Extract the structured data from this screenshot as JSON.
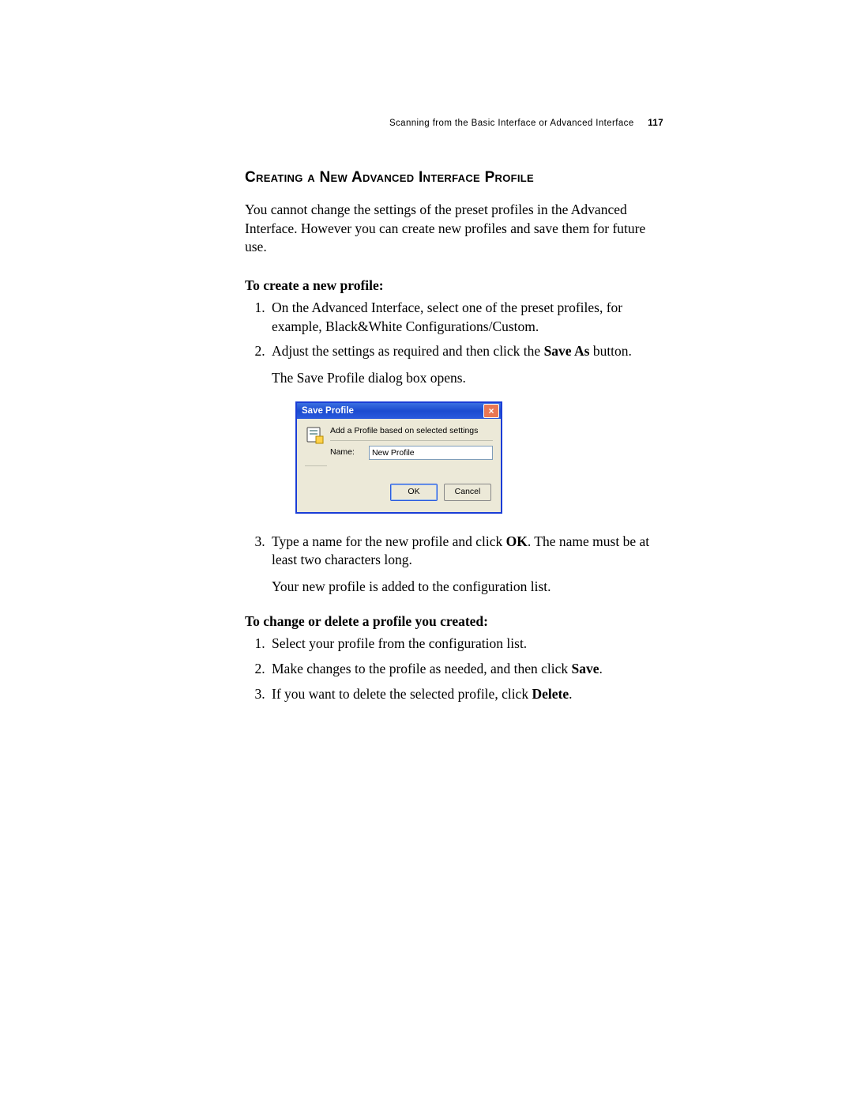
{
  "header": {
    "running_head": "Scanning from the Basic Interface or Advanced Interface",
    "page_number": "117"
  },
  "section": {
    "title": "Creating a New Advanced Interface Profile",
    "intro": "You cannot change the settings of the preset profiles in the Advanced Interface. However you can create new profiles and save them for future use."
  },
  "create_profile": {
    "heading": "To create a new profile:",
    "steps": [
      {
        "text_before": "On the Advanced Interface, select one of the preset profiles, for example, Black&White Configurations/Custom."
      },
      {
        "text_before": "Adjust the settings as required and then click the ",
        "bold": "Save As",
        "text_after": " button.",
        "extra": "The Save Profile dialog box opens."
      },
      {
        "text_before": "Type a name for the new profile and click ",
        "bold": "OK",
        "text_after": ". The name must be at least two characters long.",
        "extra": "Your new profile is added to the configuration list."
      }
    ]
  },
  "dialog": {
    "title": "Save Profile",
    "close_glyph": "×",
    "description": "Add a Profile based on selected settings",
    "name_label": "Name:",
    "name_value": "New Profile",
    "ok_label": "OK",
    "cancel_label": "Cancel"
  },
  "change_delete": {
    "heading": "To change or delete a profile you created:",
    "steps": [
      {
        "text_before": "Select your profile from the configuration list."
      },
      {
        "text_before": "Make changes to the profile as needed, and then click ",
        "bold": "Save",
        "text_after": "."
      },
      {
        "text_before": "If you want to delete the selected profile, click ",
        "bold": "Delete",
        "text_after": "."
      }
    ]
  }
}
